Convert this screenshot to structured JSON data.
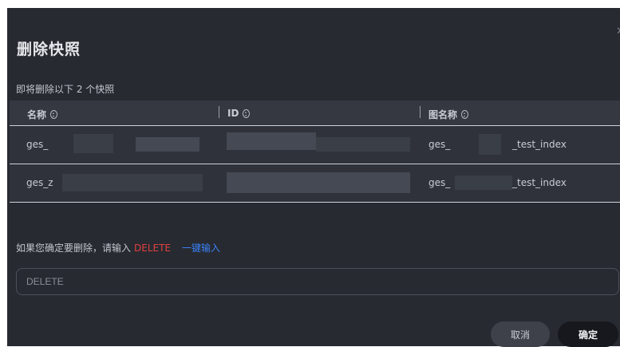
{
  "dialog": {
    "title": "删除快照",
    "subtitle": "即将删除以下 2 个快照",
    "close_icon": "close-icon"
  },
  "table": {
    "columns": [
      {
        "label": "名称",
        "sortable": true
      },
      {
        "label": "ID",
        "sortable": true
      },
      {
        "label": "图名称",
        "sortable": true
      }
    ],
    "rows": [
      {
        "name": "ges_",
        "id": "",
        "graph": "ges_",
        "graph_suffix": "_test_index"
      },
      {
        "name": "ges_z",
        "id": "",
        "graph": "ges_",
        "graph_suffix": "_test_index"
      }
    ]
  },
  "confirm_hint": {
    "prefix": "如果您确定要删除，请输入",
    "keyword": "DELETE",
    "quick_input": "一键输入"
  },
  "input": {
    "placeholder": "DELETE",
    "value": ""
  },
  "footer": {
    "cancel_label": "取消",
    "confirm_label": "确定"
  },
  "colors": {
    "background": "#272a31",
    "danger": "#e2403f",
    "link": "#3b82f6",
    "primary_button": "#16181d"
  }
}
